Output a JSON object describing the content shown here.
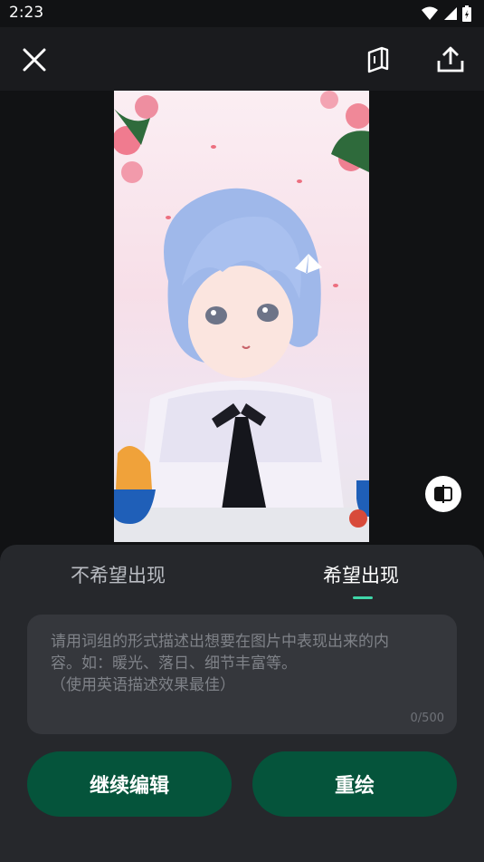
{
  "status_bar": {
    "time": "2:23",
    "icons": [
      "wifi-icon",
      "cellular-signal-icon",
      "battery-icon"
    ]
  },
  "toolbar": {
    "icons": [
      "close-icon",
      "book-icon",
      "share-upload-icon"
    ]
  },
  "artwork": {
    "description_icon": "anime-girl-illustration"
  },
  "compare_icon": "compare-icon",
  "tabs": [
    {
      "label": "不希望出现",
      "active": false
    },
    {
      "label": "希望出现",
      "active": true
    }
  ],
  "prompt": {
    "placeholder": "请用词组的形式描述出想要在图片中表现出来的内容。如：暖光、落日、细节丰富等。\n（使用英语描述效果最佳）",
    "counter": "0/500"
  },
  "buttons": {
    "continue_edit": "继续编辑",
    "redraw": "重绘"
  },
  "colors": {
    "accent": "#3fd6a8",
    "button_bg": "#05543b",
    "panel_bg": "#26282c"
  }
}
